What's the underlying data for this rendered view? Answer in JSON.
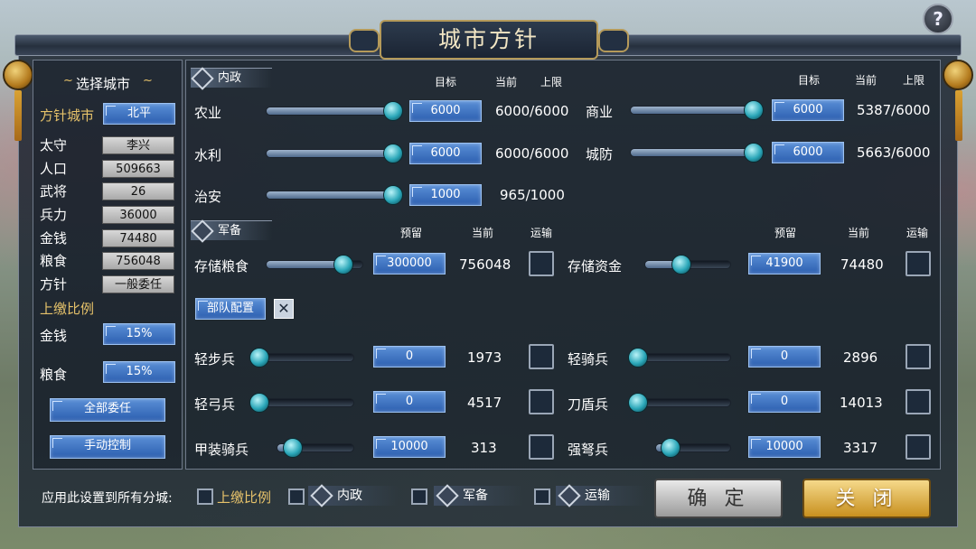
{
  "title": "城市方针",
  "help": "?",
  "left": {
    "header": "选择城市",
    "city_label": "方针城市",
    "city_value": "北平",
    "stats": [
      {
        "label": "太守",
        "value": "李兴"
      },
      {
        "label": "人口",
        "value": "509663"
      },
      {
        "label": "武将",
        "value": "26"
      },
      {
        "label": "兵力",
        "value": "36000"
      },
      {
        "label": "金钱",
        "value": "74480"
      },
      {
        "label": "粮食",
        "value": "756048"
      },
      {
        "label": "方针",
        "value": "一般委任"
      }
    ],
    "tax_header": "上缴比例",
    "tax": [
      {
        "label": "金钱",
        "value": "15%"
      },
      {
        "label": "粮食",
        "value": "15%"
      }
    ],
    "btn_all": "全部委任",
    "btn_manual": "手动控制"
  },
  "domestic": {
    "header": "内政",
    "cols": {
      "target": "目标",
      "current": "当前",
      "limit": "上限"
    },
    "rows": [
      {
        "label": "农业",
        "target": "6000",
        "current": "6000/6000",
        "pct": 1.0
      },
      {
        "label": "水利",
        "target": "6000",
        "current": "6000/6000",
        "pct": 1.0
      },
      {
        "label": "治安",
        "target": "1000",
        "current": "965/1000",
        "pct": 1.0
      },
      {
        "label": "商业",
        "target": "6000",
        "current": "5387/6000",
        "pct": 1.0
      },
      {
        "label": "城防",
        "target": "6000",
        "current": "5663/6000",
        "pct": 1.0
      }
    ]
  },
  "military": {
    "header": "军备",
    "cols": {
      "reserve": "预留",
      "current": "当前",
      "transport": "运输"
    },
    "store": [
      {
        "label": "存储粮食",
        "reserve": "300000",
        "current": "756048",
        "pct": 0.8
      },
      {
        "label": "存储资金",
        "reserve": "41900",
        "current": "74480",
        "pct": 0.43
      }
    ],
    "troop_btn": "部队配置",
    "troops": [
      {
        "label": "轻步兵",
        "reserve": "0",
        "current": "1973",
        "pct": 0.0
      },
      {
        "label": "轻弓兵",
        "reserve": "0",
        "current": "4517",
        "pct": 0.0
      },
      {
        "label": "甲装骑兵",
        "reserve": "10000",
        "current": "313",
        "pct": 0.2
      },
      {
        "label": "轻骑兵",
        "reserve": "0",
        "current": "2896",
        "pct": 0.0
      },
      {
        "label": "刀盾兵",
        "reserve": "0",
        "current": "14013",
        "pct": 0.0
      },
      {
        "label": "强弩兵",
        "reserve": "10000",
        "current": "3317",
        "pct": 0.2
      }
    ]
  },
  "bottom": {
    "apply_label": "应用此设置到所有分城:",
    "opt_tax": "上缴比例",
    "opt_domestic": "内政",
    "opt_military": "军备",
    "opt_transport": "运输",
    "confirm": "确 定",
    "close": "关 闭"
  }
}
